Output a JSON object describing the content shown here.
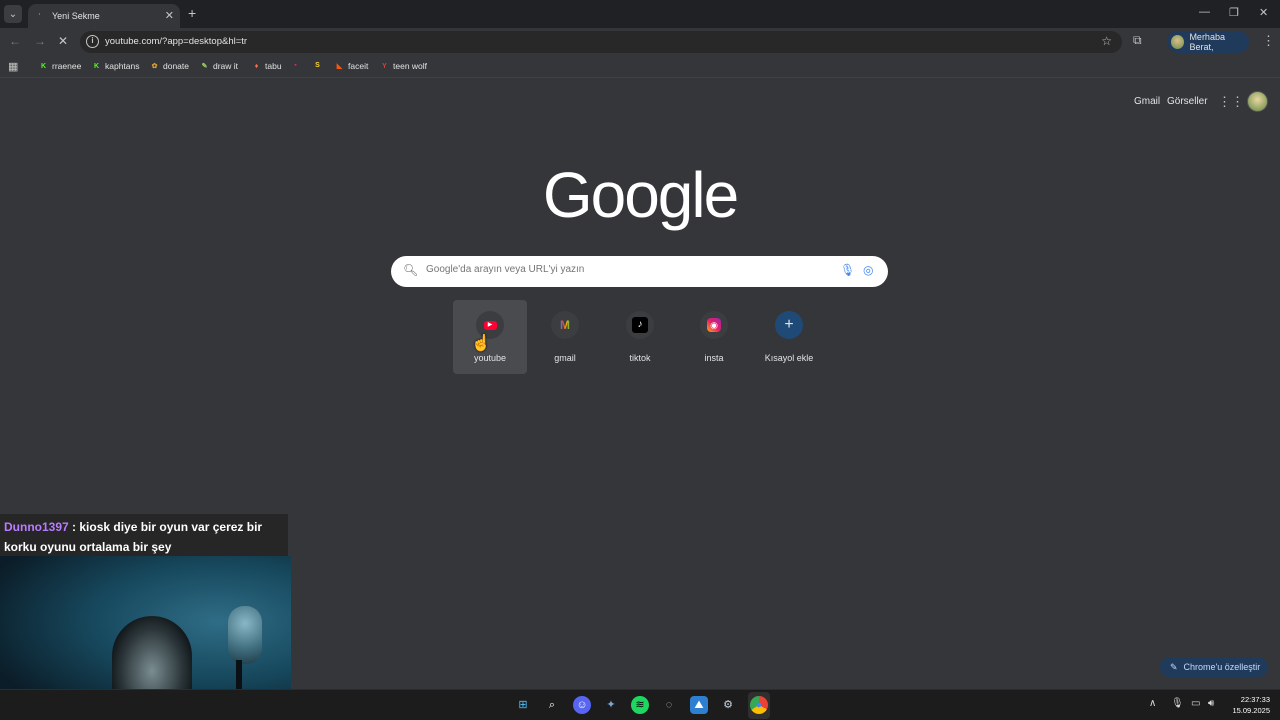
{
  "browser": {
    "tab_title": "Yeni Sekme",
    "url": "youtube.com/?app=desktop&hl=tr",
    "profile_label": "Merhaba Berat,",
    "bookmarks": [
      {
        "label": "rraenee",
        "icon": "K",
        "color": "#53fc18"
      },
      {
        "label": "kaphtans",
        "icon": "K",
        "color": "#53fc18"
      },
      {
        "label": "donate",
        "icon": "✿",
        "color": "#e0a030"
      },
      {
        "label": "draw it",
        "icon": "✎",
        "color": "#9ccc65"
      },
      {
        "label": "tabu",
        "icon": "♦",
        "color": "#ff7043"
      },
      {
        "label": "",
        "icon": "▪",
        "color": "#e91e63"
      },
      {
        "label": "",
        "icon": "S",
        "color": "#fdd835"
      },
      {
        "label": "faceit",
        "icon": "◣",
        "color": "#ff5500"
      },
      {
        "label": "teen wolf",
        "icon": "Y",
        "color": "#e53935"
      }
    ]
  },
  "google": {
    "gmail_link": "Gmail",
    "images_link": "Görseller",
    "logo": "Google",
    "search_placeholder": "Google'da arayın veya URL'yi yazın",
    "shortcuts": [
      {
        "label": "youtube",
        "icon": "youtube-icon"
      },
      {
        "label": "gmail",
        "icon": "gmail-icon"
      },
      {
        "label": "tiktok",
        "icon": "tiktok-icon"
      },
      {
        "label": "insta",
        "icon": "instagram-icon"
      },
      {
        "label": "Kısayol ekle",
        "icon": "plus-icon"
      }
    ],
    "customize_label": "Chrome'u özelleştir"
  },
  "stream_chat": {
    "username": "Dunno1397",
    "message": " : kiosk diye bir oyun var çerez bir korku oyunu ortalama bir şey"
  },
  "taskbar": {
    "time": "22:37:33",
    "date": "15.09.2025"
  }
}
